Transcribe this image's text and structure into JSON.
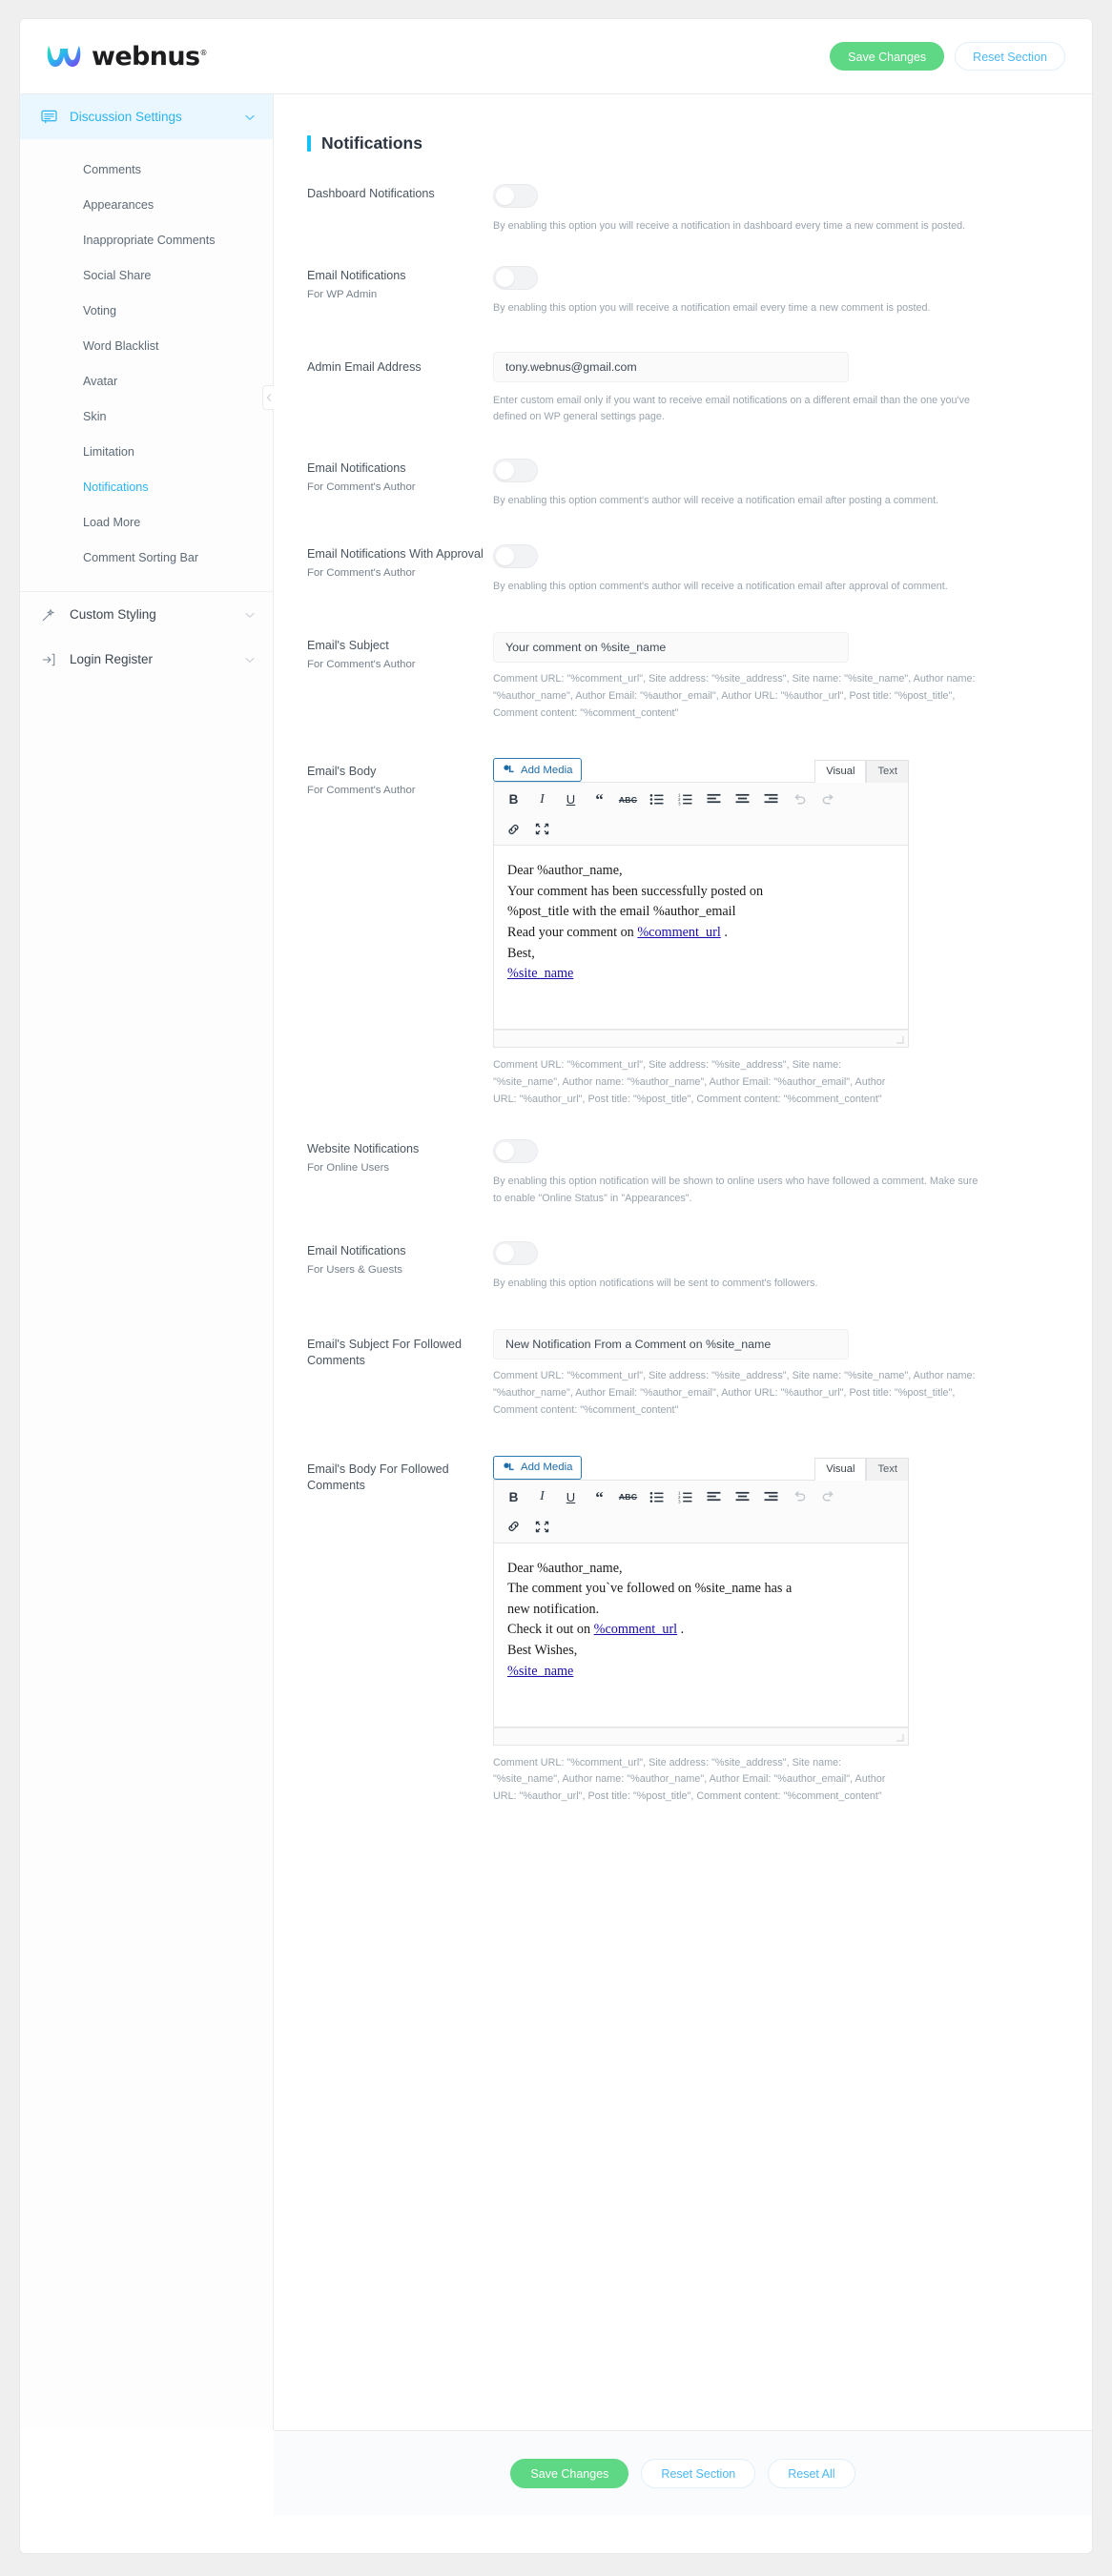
{
  "header": {
    "logo_text": "webnus",
    "logo_trademark": "®",
    "save_label": "Save Changes",
    "reset_section_label": "Reset Section"
  },
  "sidebar": {
    "groups": [
      {
        "label": "Discussion Settings",
        "icon": "comment-icon",
        "active": true,
        "items": [
          {
            "label": "Comments",
            "current": false
          },
          {
            "label": "Appearances",
            "current": false
          },
          {
            "label": "Inappropriate Comments",
            "current": false
          },
          {
            "label": "Social Share",
            "current": false
          },
          {
            "label": "Voting",
            "current": false
          },
          {
            "label": "Word Blacklist",
            "current": false
          },
          {
            "label": "Avatar",
            "current": false
          },
          {
            "label": "Skin",
            "current": false
          },
          {
            "label": "Limitation",
            "current": false
          },
          {
            "label": "Notifications",
            "current": true
          },
          {
            "label": "Load More",
            "current": false
          },
          {
            "label": "Comment Sorting Bar",
            "current": false
          }
        ]
      },
      {
        "label": "Custom Styling",
        "icon": "magic-wand-icon",
        "active": false,
        "items": []
      },
      {
        "label": "Login Register",
        "icon": "login-arrow-icon",
        "active": false,
        "items": []
      }
    ]
  },
  "main": {
    "section_title": "Notifications",
    "placeholder_variables": "Comment URL: \"%comment_url\", Site address: \"%site_address\", Site name: \"%site_name\", Author name: \"%author_name\", Author Email: \"%author_email\", Author URL: \"%author_url\", Post title: \"%post_title\", Comment content: \"%comment_content\"",
    "rows": {
      "dashboard_notifications": {
        "label": "Dashboard Notifications",
        "sub": "",
        "toggle_state": "off",
        "hint": "By enabling this option you will receive a notification in dashboard every time a new comment is posted."
      },
      "email_notifications_wp_admin": {
        "label": "Email Notifications",
        "sub": "For WP Admin",
        "toggle_state": "off",
        "hint": "By enabling this option you will receive a notification email every time a new comment is posted."
      },
      "admin_email_address": {
        "label": "Admin Email Address",
        "sub": "",
        "value": "tony.webnus@gmail.com",
        "hint": "Enter custom email only if you want to receive email notifications on a different email than the one you've defined on WP general settings page."
      },
      "email_notifications_author": {
        "label": "Email Notifications",
        "sub": "For Comment's Author",
        "toggle_state": "off",
        "hint": "By enabling this option comment's author will receive a notification email after posting a comment."
      },
      "email_notifications_approval": {
        "label": "Email Notifications With Approval",
        "sub": "For Comment's Author",
        "toggle_state": "off",
        "hint": "By enabling this option comment's author will receive a notification email after approval of comment."
      },
      "email_subject": {
        "label": "Email's Subject",
        "sub": "For Comment's Author",
        "value": "Your comment on %site_name"
      },
      "email_body": {
        "label": "Email's Body",
        "sub": "For Comment's Author",
        "add_media_label": "Add Media",
        "tab_visual": "Visual",
        "tab_text": "Text",
        "content_lines": [
          "Dear %author_name,",
          "Your comment has been successfully posted on",
          "%post_title with the email %author_email"
        ],
        "line_link_prefix": "Read your comment on ",
        "line_link": "%comment_url",
        "line_link_suffix": " .",
        "signoff": "Best,",
        "site_link": "%site_name"
      },
      "website_notifications": {
        "label": "Website Notifications",
        "sub": "For Online Users",
        "toggle_state": "off",
        "hint": "By enabling this option notification will be shown to online users who have followed a comment. Make sure to enable \"Online Status\" in \"Appearances\"."
      },
      "email_notifications_users_guests": {
        "label": "Email Notifications",
        "sub": "For Users & Guests",
        "toggle_state": "off",
        "hint": "By enabling this option notifications will be sent to comment's followers."
      },
      "email_subject_followed": {
        "label": "Email's Subject For Followed Comments",
        "sub": "",
        "value": "New Notification From a Comment on %site_name"
      },
      "email_body_followed": {
        "label": "Email's Body For Followed Comments",
        "sub": "",
        "add_media_label": "Add Media",
        "tab_visual": "Visual",
        "tab_text": "Text",
        "content_lines": [
          "Dear %author_name,",
          "The comment you`ve followed on %site_name has a",
          "new notification."
        ],
        "line_link_prefix": "Check it out on ",
        "line_link": "%comment_url",
        "line_link_suffix": " .",
        "signoff": "Best Wishes,",
        "site_link": "%site_name"
      }
    },
    "editor_toolbar": {
      "bold": "B",
      "italic": "I",
      "underline": "U",
      "blockquote": "“",
      "strikethrough": "ABC",
      "bullet_list": "bullet-list-icon",
      "numbered_list": "numbered-list-icon",
      "align_left": "align-left-icon",
      "align_center": "align-center-icon",
      "align_right": "align-right-icon",
      "undo": "undo-icon",
      "redo": "redo-icon",
      "link": "link-icon",
      "fullscreen": "fullscreen-icon"
    }
  },
  "footer": {
    "save_label": "Save Changes",
    "reset_section_label": "Reset Section",
    "reset_all_label": "Reset All"
  },
  "colors": {
    "accent_blue": "#2bb4f0",
    "save_green": "#5ed884",
    "title_bar": "#19c0f4",
    "link_blue": "#1a0dab"
  }
}
